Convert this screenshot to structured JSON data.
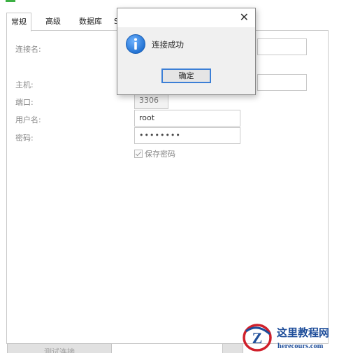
{
  "tabs": [
    {
      "label": "常规"
    },
    {
      "label": "高级"
    },
    {
      "label": "数据库"
    },
    {
      "label": "S"
    }
  ],
  "form": {
    "connection_name_label": "连接名:",
    "host_label": "主机:",
    "port_label": "端口:",
    "port_value": "3306",
    "username_label": "用户名:",
    "username_value": "root",
    "password_label": "密码:",
    "password_mask": "••••••••",
    "save_password_label": "保存密码",
    "save_password_checked": true
  },
  "bottom_buttons": {
    "test_connection_label": "测试连接"
  },
  "dialog": {
    "message": "连接成功",
    "ok_label": "确定",
    "close_glyph": "✕",
    "icon": "info-icon"
  },
  "watermark": {
    "site_name": "这里教程网",
    "site_url": "herecours.com"
  },
  "colors": {
    "dialog_button_border": "#3c7fd6",
    "info_icon": "#1f6fd0",
    "watermark_red": "#d0202b",
    "watermark_blue": "#1f4e9a"
  }
}
